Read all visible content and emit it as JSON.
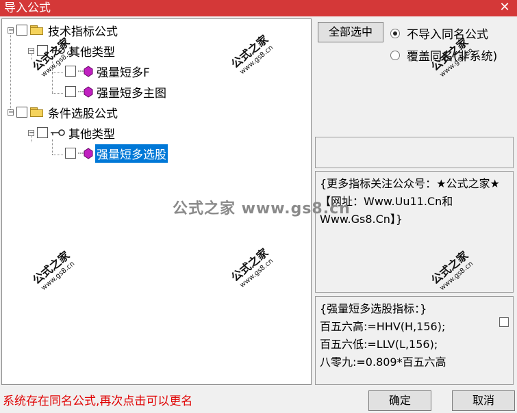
{
  "window": {
    "title": "导入公式",
    "close_glyph": "✕"
  },
  "tree": {
    "nodes": [
      {
        "label": "技术指标公式",
        "icon": "folder-icon",
        "expander": "−"
      },
      {
        "label": "其他类型",
        "icon": "key-icon",
        "expander": "−"
      },
      {
        "label": "强量短多F",
        "icon": "formula-icon"
      },
      {
        "label": "强量短多主图",
        "icon": "formula-icon"
      },
      {
        "label": "条件选股公式",
        "icon": "folder-icon",
        "expander": "−"
      },
      {
        "label": "其他类型",
        "icon": "key-icon",
        "expander": "−"
      },
      {
        "label": "强量短多选股",
        "icon": "formula-icon",
        "selected": true
      }
    ]
  },
  "buttons": {
    "select_all": "全部选中",
    "ok": "确定",
    "cancel": "取消"
  },
  "options": {
    "no_import_same_name": "不导入同名公式",
    "overwrite_same_name": "覆盖同名(非系统)",
    "selected": "no_import_same_name"
  },
  "description": "{更多指标关注公众号：★公式之家★ 【网址：Www.Uu11.Cn和Www.Gs8.Cn】}",
  "code_lines": [
    "{强量短多选股指标：}",
    "百五六高:=HHV(H,156);",
    "百五六低:=LLV(L,156);",
    "八零九:=0.809*百五六高"
  ],
  "status_text": "系统存在同名公式,再次点击可以更名",
  "watermark": {
    "text": "公式之家",
    "url": "www.gs8.cn",
    "banner": "公式之家 www.gs8.cn"
  },
  "colors": {
    "title_bar": "#d43838",
    "selection": "#0078d7",
    "status_text": "#e00000"
  }
}
